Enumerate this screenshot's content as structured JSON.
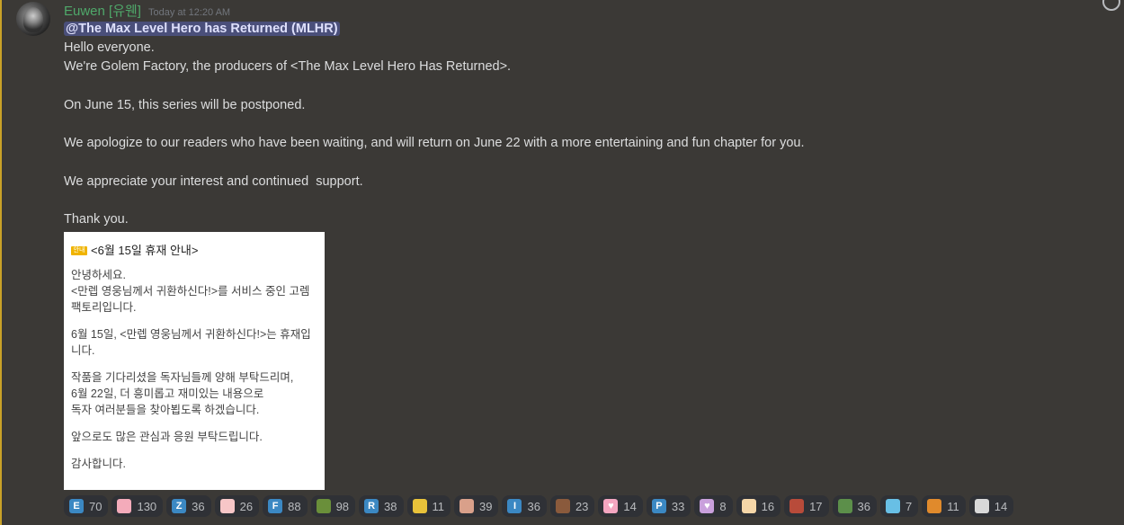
{
  "message": {
    "username": "Euwen [유웬]",
    "timestamp": "Today at 12:20 AM",
    "mention": "@The Max Level Hero has Returned (MLHR)",
    "lines": [
      "Hello everyone.",
      "We're Golem Factory, the producers of <The Max Level Hero Has Returned>.",
      "",
      "On June 15, this series will be postponed.",
      "",
      "We apologize to our readers who have been waiting, and will return on June 22 with a more entertaining and fun chapter for you.",
      "",
      "We appreciate your interest and continued  support.",
      "",
      "Thank you."
    ]
  },
  "embed": {
    "badge": "안내",
    "title": "<6월 15일 휴재 안내>",
    "paragraphs": [
      "안녕하세요.\n<만렙 영웅님께서 귀환하신다!>를 서비스 중인 고렘\n팩토리입니다.",
      "6월 15일, <만렙 영웅님께서 귀환하신다!>는 휴재입\n니다.",
      "작품을 기다리셨을 독자님들께 양해 부탁드리며,\n6월 22일, 더 흥미롭고 재미있는 내용으로\n독자 여러분들을 찾아뵙도록 하겠습니다.",
      "앞으로도 많은 관심과 응원 부탁드립니다.",
      "감사합니다."
    ]
  },
  "reactions": [
    {
      "icon": "letter-e-icon",
      "glyph": "E",
      "color": "#3b88c3",
      "count": "70"
    },
    {
      "icon": "pig-face-icon",
      "glyph": "",
      "color": "#f4abba",
      "count": "130"
    },
    {
      "icon": "letter-z-icon",
      "glyph": "Z",
      "color": "#3b88c3",
      "count": "36"
    },
    {
      "icon": "character-face-icon",
      "glyph": "",
      "color": "#f7c6c7",
      "count": "26"
    },
    {
      "icon": "letter-f-icon",
      "glyph": "F",
      "color": "#3b88c3",
      "count": "88"
    },
    {
      "icon": "green-emote-icon",
      "glyph": "",
      "color": "#6a8f3a",
      "count": "98"
    },
    {
      "icon": "letter-r-icon",
      "glyph": "R",
      "color": "#3b88c3",
      "count": "38"
    },
    {
      "icon": "yellow-emote-icon",
      "glyph": "",
      "color": "#e8c23a",
      "count": "11"
    },
    {
      "icon": "hand-emote-icon",
      "glyph": "",
      "color": "#d9a08a",
      "count": "39"
    },
    {
      "icon": "letter-i-icon",
      "glyph": "I",
      "color": "#3b88c3",
      "count": "36"
    },
    {
      "icon": "pixel-emote-icon",
      "glyph": "",
      "color": "#8a5a3c",
      "count": "23"
    },
    {
      "icon": "pink-heart-icon",
      "glyph": "♥",
      "color": "#f4a6c0",
      "count": "14"
    },
    {
      "icon": "letter-p-icon",
      "glyph": "P",
      "color": "#3b88c3",
      "count": "33"
    },
    {
      "icon": "heart-emote-icon",
      "glyph": "♥",
      "color": "#c9a0dc",
      "count": "8"
    },
    {
      "icon": "waving-hand-icon",
      "glyph": "",
      "color": "#f5d6a8",
      "count": "16"
    },
    {
      "icon": "red-emote-icon",
      "glyph": "",
      "color": "#b84b3a",
      "count": "17"
    },
    {
      "icon": "frog-emote-icon",
      "glyph": "",
      "color": "#5c8f4a",
      "count": "36"
    },
    {
      "icon": "fiji-flag-icon",
      "glyph": "",
      "color": "#68bfe5",
      "count": "7"
    },
    {
      "icon": "box-emote-icon",
      "glyph": "",
      "color": "#e08a2c",
      "count": "11"
    },
    {
      "icon": "person-emote-icon",
      "glyph": "",
      "color": "#d8d8d8",
      "count": "14"
    }
  ]
}
